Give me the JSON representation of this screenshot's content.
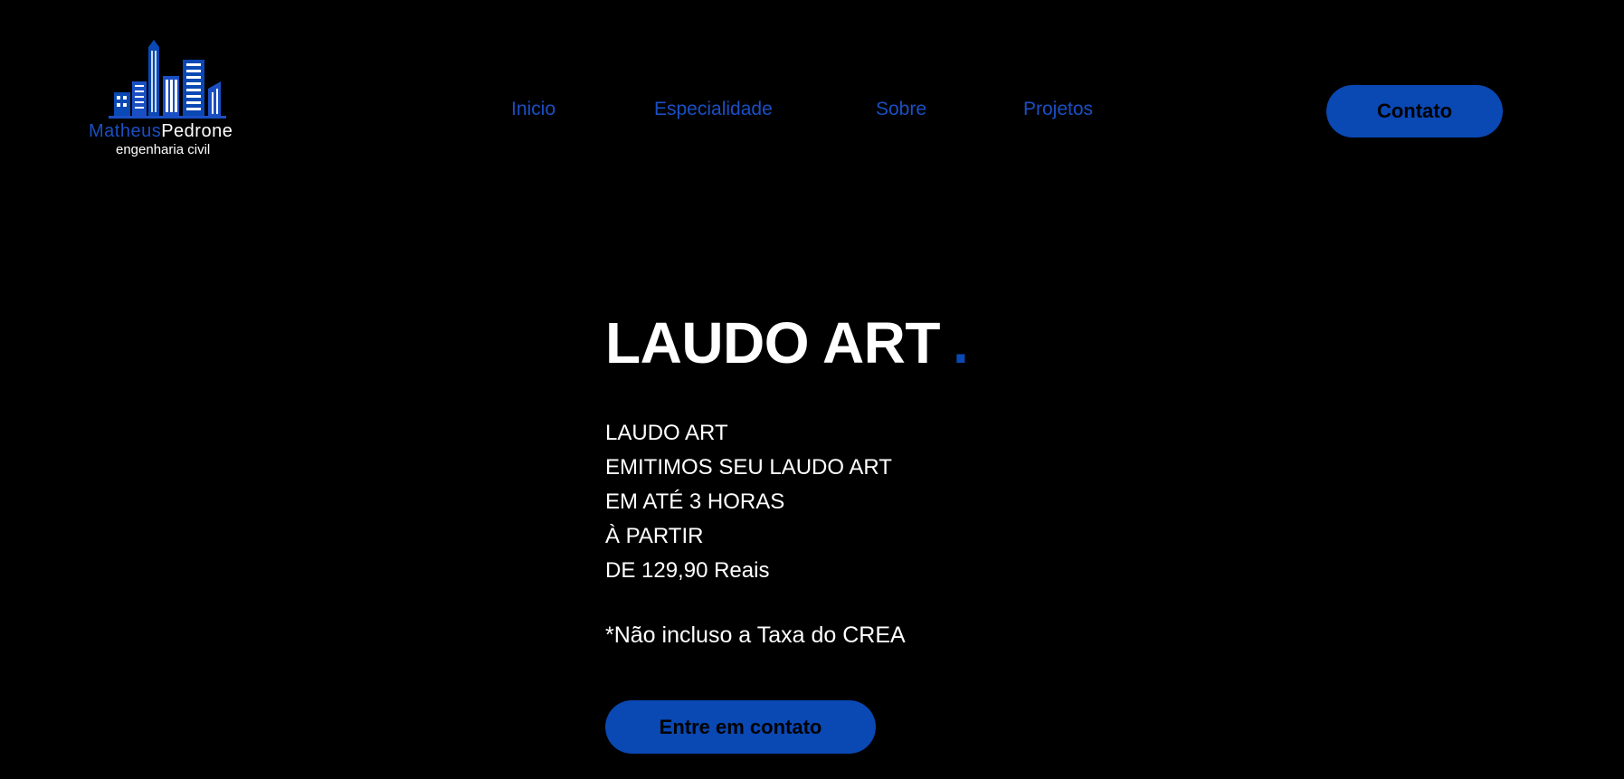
{
  "logo": {
    "name_first": "Matheus",
    "name_last": "Pedrone",
    "tagline": "engenharia civil",
    "icon": "city-skyline-icon"
  },
  "nav": {
    "items": [
      {
        "label": "Inicio"
      },
      {
        "label": "Especialidade"
      },
      {
        "label": "Sobre"
      },
      {
        "label": "Projetos"
      }
    ],
    "cta_label": "Contato"
  },
  "hero": {
    "title": "LAUDO ART",
    "title_dot": ".",
    "lines": [
      "LAUDO ART",
      "EMITIMOS SEU LAUDO ART",
      "EM ATÉ 3 HORAS",
      "À PARTIR",
      "DE 129,90 Reais"
    ],
    "note": "*Não incluso a Taxa do CREA",
    "cta_label": "Entre em contato"
  },
  "colors": {
    "background": "#000000",
    "accent": "#0a48b3",
    "nav_link": "#1a4fc4",
    "text": "#ffffff"
  }
}
